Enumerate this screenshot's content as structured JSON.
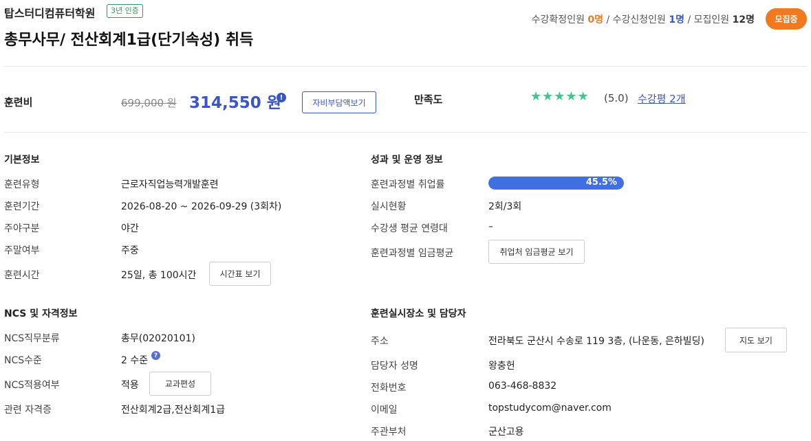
{
  "header": {
    "academy": "탑스터디컴퓨터학원",
    "cert_badge": "3년 인증",
    "course_title": "총무사무/ 전산회계1급(단기속성) 취득",
    "stats": {
      "confirmed_label": "수강확정인원",
      "confirmed_value": "0명",
      "applied_label": "수강신청인원",
      "applied_value": "1명",
      "recruit_label": "모집인원",
      "recruit_value": "12명",
      "sep": "/"
    },
    "status_pill": "모집중"
  },
  "fee": {
    "label": "훈련비",
    "original_price": "699,000 원",
    "sale_price": "314,550 원",
    "info_icon": "!",
    "self_pay_button": "자비부담액보기",
    "satisfaction_label": "만족도",
    "stars": "★★★★★",
    "rating": "(5.0)",
    "review_link": "수강평 2개"
  },
  "basic_info": {
    "title": "기본정보",
    "rows": [
      {
        "label": "훈련유형",
        "value": "근로자직업능력개발훈련"
      },
      {
        "label": "훈련기간",
        "value": "2026-08-20 ~ 2026-09-29 (3회차)"
      },
      {
        "label": "주야구분",
        "value": "야간"
      },
      {
        "label": "주말여부",
        "value": "주중"
      },
      {
        "label": "훈련시간",
        "value": "25일, 총 100시간"
      }
    ],
    "timetable_button": "시간표 보기"
  },
  "performance": {
    "title": "성과 및 운영 정보",
    "employment_label": "훈련과정별 취업률",
    "employment_value": "45.5%",
    "employment_fraction": 0.455,
    "status_label": "실시현황",
    "status_value": "2회/3회",
    "age_label": "수강생 평균 연령대",
    "age_value": "–",
    "wage_label": "훈련과정별 임금평균",
    "wage_button": "취업처 임금평균 보기"
  },
  "ncs": {
    "title": "NCS 및 자격정보",
    "class_label": "NCS직무분류",
    "class_value": "총무(02020101)",
    "level_label": "NCS수준",
    "level_value": "2 수준",
    "level_icon": "?",
    "apply_label": "NCS적용여부",
    "apply_value": "적용",
    "curriculum_button": "교과편성",
    "cert_label": "관련 자격증",
    "cert_value": "전산회계2급,전산회계1급"
  },
  "location": {
    "title": "훈련실시장소 및 담당자",
    "address_label": "주소",
    "address_value": "전라북도 군산시 수송로 119 3층, (나운동, 은하빌딩)",
    "map_button": "지도 보기",
    "manager_label": "담당자 성명",
    "manager_value": "왕충헌",
    "phone_label": "전화번호",
    "phone_value": "063-468-8832",
    "email_label": "이메일",
    "email_value": "topstudycom@naver.com",
    "dept_label": "주관부처",
    "dept_value": "군산고용"
  },
  "colors": {
    "accent_blue": "#3a56c5",
    "orange": "#f07a1f",
    "green": "#45c48a",
    "bar_blue": "#3f6fe0"
  }
}
